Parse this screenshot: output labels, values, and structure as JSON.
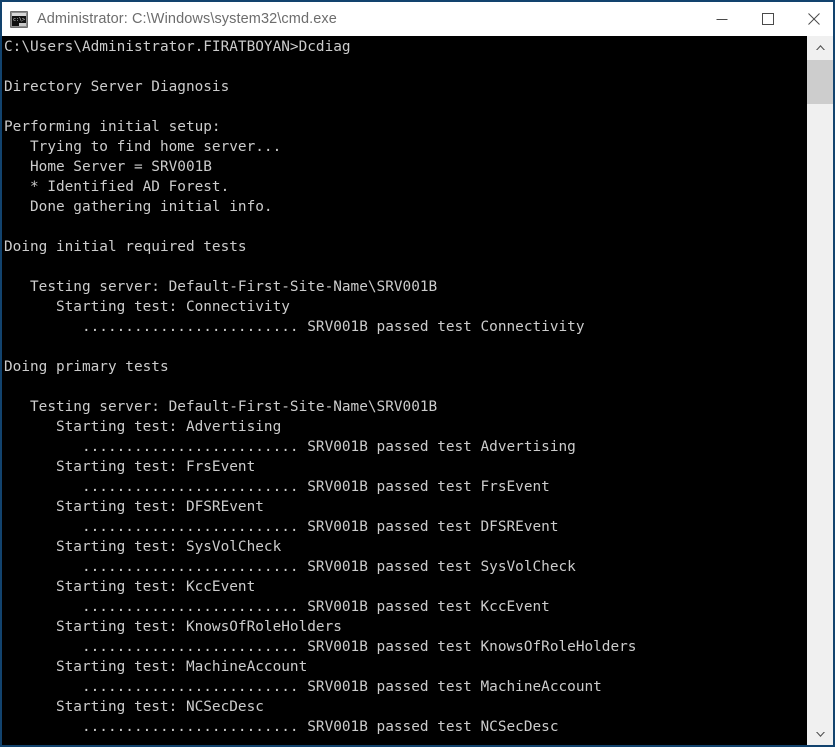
{
  "window": {
    "title": "Administrator: C:\\Windows\\system32\\cmd.exe",
    "icon": "console-window-icon",
    "controls": {
      "minimize": "Minimize",
      "maximize": "Maximize",
      "close": "Close"
    }
  },
  "console": {
    "prompt": "C:\\Users\\Administrator.FIRATBOYAN>",
    "command": "Dcdiag",
    "home_server": "SRV001B",
    "site": "Default-First-Site-Name",
    "text": "C:\\Users\\Administrator.FIRATBOYAN>Dcdiag\n\nDirectory Server Diagnosis\n\nPerforming initial setup:\n   Trying to find home server...\n   Home Server = SRV001B\n   * Identified AD Forest.\n   Done gathering initial info.\n\nDoing initial required tests\n\n   Testing server: Default-First-Site-Name\\SRV001B\n      Starting test: Connectivity\n         ......................... SRV001B passed test Connectivity\n\nDoing primary tests\n\n   Testing server: Default-First-Site-Name\\SRV001B\n      Starting test: Advertising\n         ......................... SRV001B passed test Advertising\n      Starting test: FrsEvent\n         ......................... SRV001B passed test FrsEvent\n      Starting test: DFSREvent\n         ......................... SRV001B passed test DFSREvent\n      Starting test: SysVolCheck\n         ......................... SRV001B passed test SysVolCheck\n      Starting test: KccEvent\n         ......................... SRV001B passed test KccEvent\n      Starting test: KnowsOfRoleHolders\n         ......................... SRV001B passed test KnowsOfRoleHolders\n      Starting test: MachineAccount\n         ......................... SRV001B passed test MachineAccount\n      Starting test: NCSecDesc\n         ......................... SRV001B passed test NCSecDesc",
    "tests": [
      {
        "name": "Connectivity",
        "result": "passed"
      },
      {
        "name": "Advertising",
        "result": "passed"
      },
      {
        "name": "FrsEvent",
        "result": "passed"
      },
      {
        "name": "DFSREvent",
        "result": "passed"
      },
      {
        "name": "SysVolCheck",
        "result": "passed"
      },
      {
        "name": "KccEvent",
        "result": "passed"
      },
      {
        "name": "KnowsOfRoleHolders",
        "result": "passed"
      },
      {
        "name": "MachineAccount",
        "result": "passed"
      },
      {
        "name": "NCSecDesc",
        "result": "passed"
      }
    ]
  },
  "scrollbar": {
    "up_arrow": "chevron-up-icon",
    "down_arrow": "chevron-down-icon"
  },
  "colors": {
    "window_border": "#12436e",
    "titlebar_bg": "#ffffff",
    "title_text": "#6d6d6d",
    "console_bg": "#000000",
    "console_text": "#cccccc",
    "scrollbar_track": "#f0f0f0",
    "scrollbar_thumb": "#cdcdcd"
  }
}
